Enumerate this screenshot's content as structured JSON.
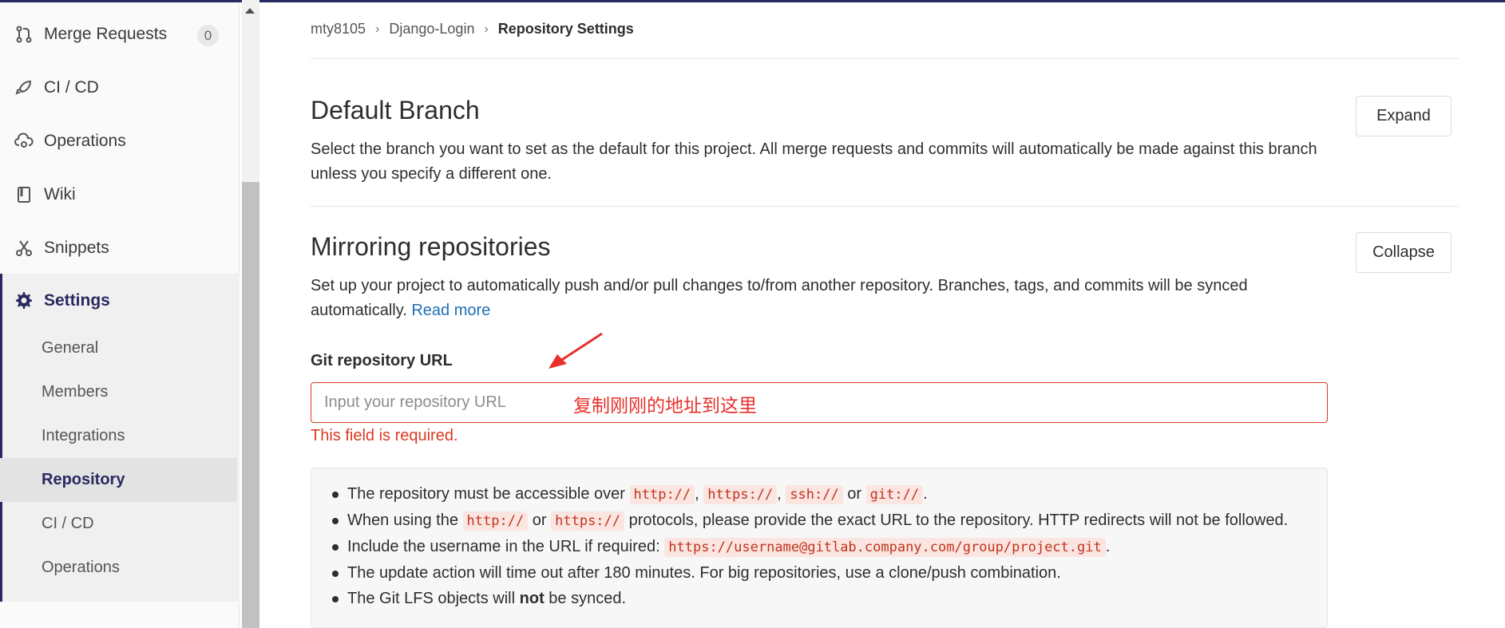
{
  "sidebar": {
    "items": [
      {
        "label": "Merge Requests",
        "icon": "merge-request-icon",
        "badge": "0"
      },
      {
        "label": "CI / CD",
        "icon": "rocket-icon"
      },
      {
        "label": "Operations",
        "icon": "cloud-gear-icon"
      },
      {
        "label": "Wiki",
        "icon": "book-icon"
      },
      {
        "label": "Snippets",
        "icon": "scissors-icon"
      },
      {
        "label": "Settings",
        "icon": "gear-icon"
      }
    ],
    "settings_sub": [
      {
        "label": "General"
      },
      {
        "label": "Members"
      },
      {
        "label": "Integrations"
      },
      {
        "label": "Repository"
      },
      {
        "label": "CI / CD"
      },
      {
        "label": "Operations"
      }
    ]
  },
  "breadcrumb": {
    "items": [
      "mty8105",
      "Django-Login",
      "Repository Settings"
    ]
  },
  "default_branch": {
    "title": "Default Branch",
    "description": "Select the branch you want to set as the default for this project. All merge requests and commits will automatically be made against this branch unless you specify a different one.",
    "button": "Expand"
  },
  "mirroring": {
    "title": "Mirroring repositories",
    "description": "Set up your project to automatically push and/or pull changes to/from another repository. Branches, tags, and commits will be synced automatically.",
    "read_more": "Read more",
    "button": "Collapse",
    "field_label": "Git repository URL",
    "input_placeholder": "Input your repository URL",
    "input_value": "",
    "annotation": "复制刚刚的地址到这里",
    "error": "This field is required.",
    "info": {
      "l1_text": "The repository must be accessible over",
      "l1_codes": [
        "http://",
        "https://",
        "ssh://",
        "git://"
      ],
      "l1_or": "or",
      "l2_prefix": "When using the",
      "l2_codes": [
        "http://",
        "https://"
      ],
      "l2_or": "or",
      "l2_suffix": "protocols, please provide the exact URL to the repository. HTTP redirects will not be followed.",
      "l3_prefix": "Include the username in the URL if required:",
      "l3_code": "https://username@gitlab.company.com/group/project.git",
      "l4": "The update action will time out after 180 minutes. For big repositories, use a clone/push combination.",
      "l5_prefix": "The Git LFS objects will",
      "l5_bold": "not",
      "l5_suffix": "be synced."
    }
  },
  "colors": {
    "accent": "#292961",
    "error": "#db3b21",
    "link": "#1f6fb5",
    "annotation": "#e8302c"
  }
}
